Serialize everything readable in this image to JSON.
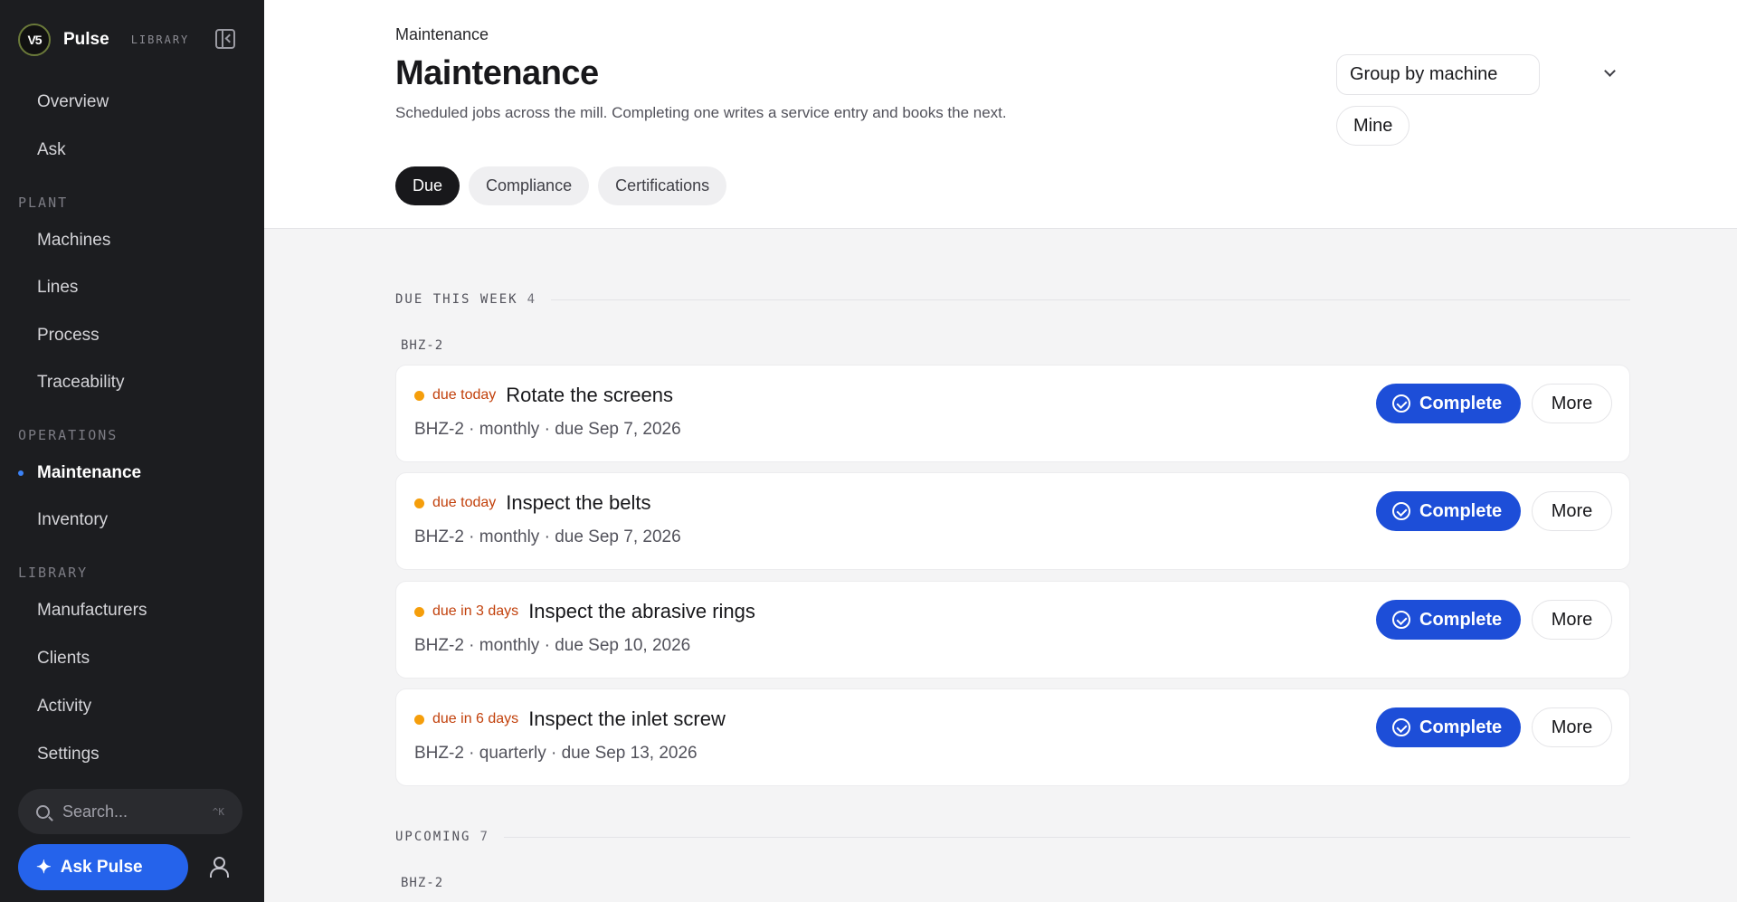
{
  "sidebar": {
    "logo_text": "V5",
    "app_name": "Pulse",
    "app_tag": "LIBRARY",
    "top_items": [
      {
        "label": "Overview"
      },
      {
        "label": "Ask"
      }
    ],
    "sections": [
      {
        "label": "PLANT",
        "items": [
          {
            "label": "Machines"
          },
          {
            "label": "Lines"
          },
          {
            "label": "Process"
          },
          {
            "label": "Traceability"
          }
        ]
      },
      {
        "label": "OPERATIONS",
        "items": [
          {
            "label": "Maintenance"
          },
          {
            "label": "Inventory"
          }
        ]
      },
      {
        "label": "LIBRARY",
        "items": [
          {
            "label": "Manufacturers"
          },
          {
            "label": "Clients"
          },
          {
            "label": "Activity"
          },
          {
            "label": "Settings"
          }
        ]
      }
    ],
    "active_item": "Maintenance",
    "search_placeholder": "Search...",
    "search_shortcut": "^K",
    "ask_button": "Ask Pulse"
  },
  "header": {
    "breadcrumb": "Maintenance",
    "title": "Maintenance",
    "subtitle": "Scheduled jobs across the mill. Completing one writes a service entry and books the next.",
    "tabs": [
      {
        "label": "Due"
      },
      {
        "label": "Compliance"
      },
      {
        "label": "Certifications"
      }
    ],
    "active_tab": "Due",
    "group_select_value": "Group by machine",
    "mine_button": "Mine"
  },
  "groups": [
    {
      "label": "DUE THIS WEEK",
      "count": "4",
      "machine": "BHZ-2",
      "jobs": [
        {
          "due": "due today",
          "title": "Rotate the screens",
          "meta": "BHZ-2 · monthly · due Sep 7, 2026"
        },
        {
          "due": "due today",
          "title": "Inspect the belts",
          "meta": "BHZ-2 · monthly · due Sep 7, 2026"
        },
        {
          "due": "due in 3 days",
          "title": "Inspect the abrasive rings",
          "meta": "BHZ-2 · monthly · due Sep 10, 2026"
        },
        {
          "due": "due in 6 days",
          "title": "Inspect the inlet screw",
          "meta": "BHZ-2 · quarterly · due Sep 13, 2026"
        }
      ]
    },
    {
      "label": "UPCOMING",
      "count": "7",
      "machine": "BHZ-2",
      "jobs": []
    }
  ],
  "job_actions": {
    "complete": "Complete",
    "more": "More"
  },
  "colors": {
    "accent": "#1d4ed8",
    "due_dot": "#f59e0b",
    "due_text": "#c2410c",
    "sidebar_bg": "#1c1d20"
  }
}
